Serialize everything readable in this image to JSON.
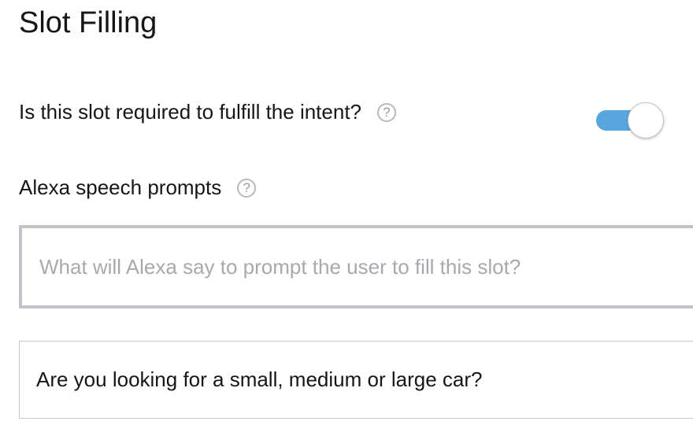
{
  "section": {
    "title": "Slot Filling"
  },
  "required": {
    "label": "Is this slot required to fulfill the intent?",
    "help_glyph": "?",
    "toggle_on": true,
    "toggle_color": "#58a6e0"
  },
  "prompts": {
    "label": "Alexa speech prompts",
    "help_glyph": "?",
    "input_placeholder": "What will Alexa say to prompt the user to fill this slot?",
    "input_value": "",
    "items": [
      {
        "text": "Are you looking for a small, medium or large car?"
      }
    ]
  },
  "icons": {
    "help": "question-circle-icon"
  }
}
